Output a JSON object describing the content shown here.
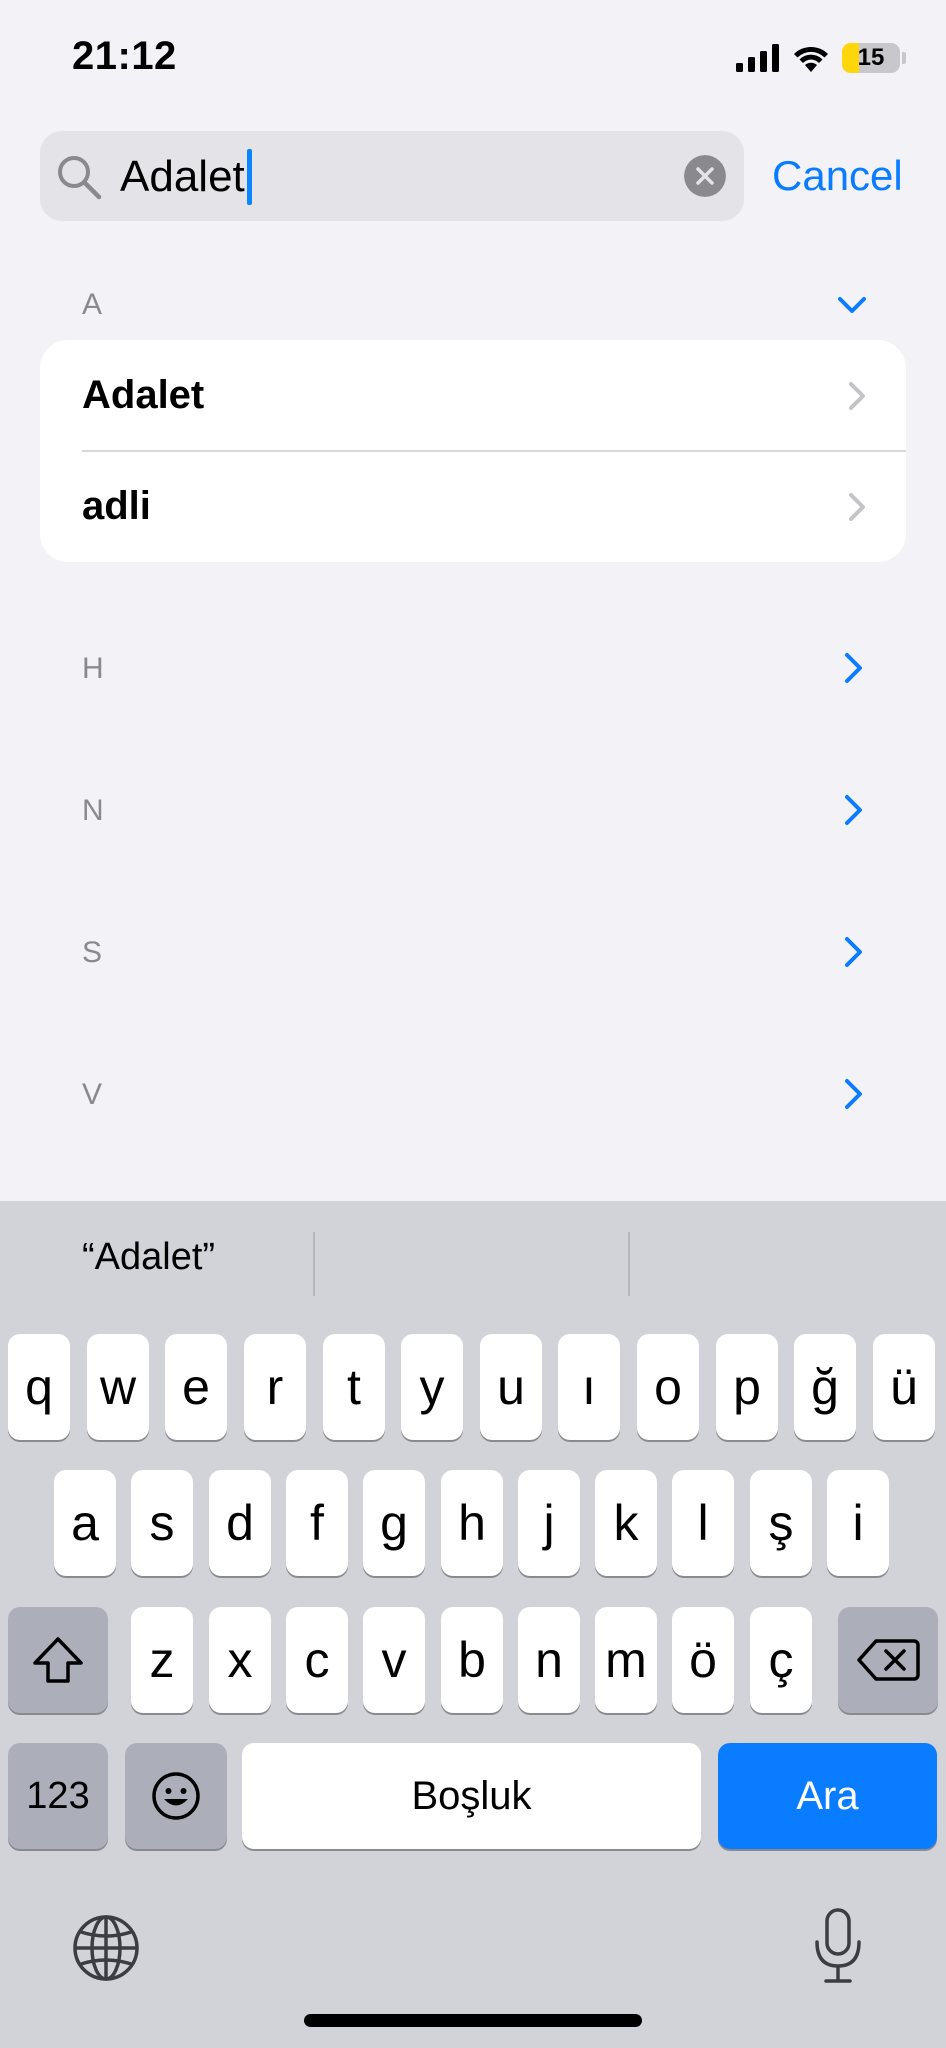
{
  "status_bar": {
    "time": "21:12",
    "battery": "15",
    "icons": [
      "cellular-signal-icon",
      "wifi-icon",
      "battery-icon"
    ]
  },
  "search": {
    "value": "Adalet",
    "cancel_label": "Cancel"
  },
  "sections": [
    {
      "letter": "A",
      "expanded": true,
      "items": [
        "Adalet",
        "adli"
      ]
    },
    {
      "letter": "H",
      "expanded": false
    },
    {
      "letter": "N",
      "expanded": false
    },
    {
      "letter": "S",
      "expanded": false
    },
    {
      "letter": "V",
      "expanded": false
    }
  ],
  "keyboard": {
    "suggestion": "“Adalet”",
    "row1": [
      "q",
      "w",
      "e",
      "r",
      "t",
      "y",
      "u",
      "ı",
      "o",
      "p",
      "ğ",
      "ü"
    ],
    "row2": [
      "a",
      "s",
      "d",
      "f",
      "g",
      "h",
      "j",
      "k",
      "l",
      "ş",
      "i"
    ],
    "row3": [
      "z",
      "x",
      "c",
      "v",
      "b",
      "n",
      "m",
      "ö",
      "ç"
    ],
    "numbers_label": "123",
    "space_label": "Boşluk",
    "return_label": "Ara"
  },
  "colors": {
    "accent": "#0a7cff",
    "background": "#f2f2f7",
    "battery": "#ffd60a"
  }
}
